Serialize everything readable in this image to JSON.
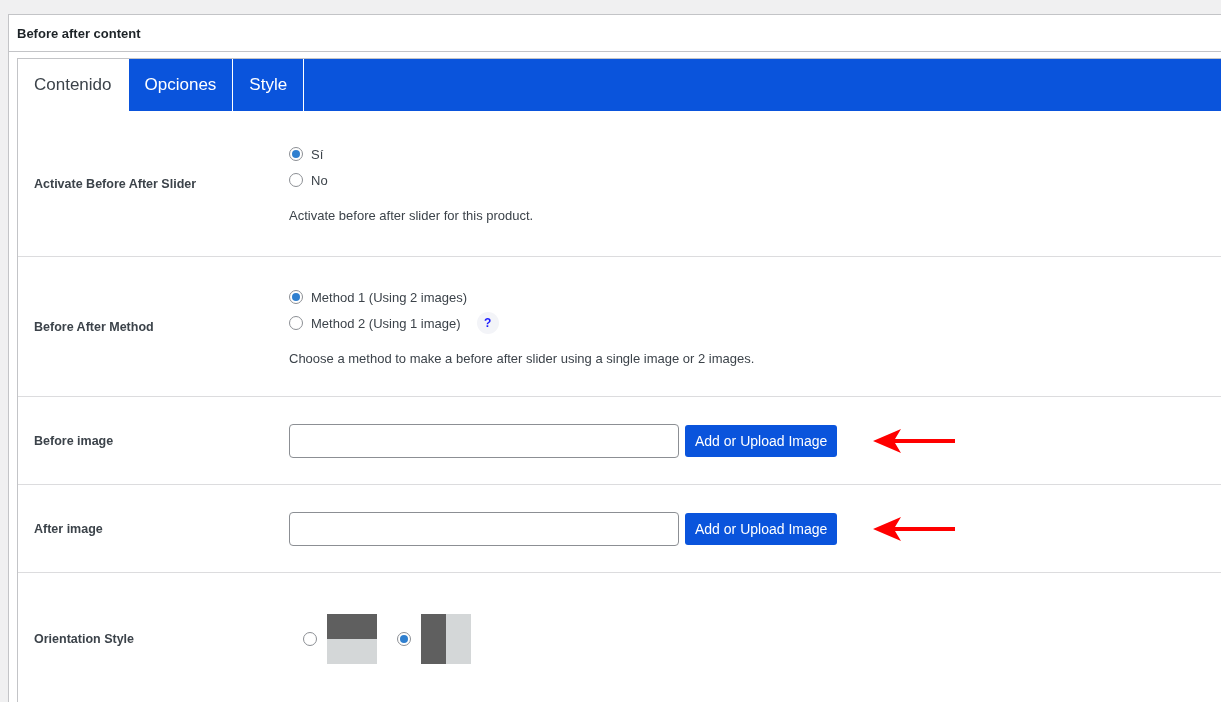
{
  "panel": {
    "title": "Before after content"
  },
  "tabs": [
    {
      "label": "Contenido",
      "selected": true
    },
    {
      "label": "Opciones",
      "selected": false
    },
    {
      "label": "Style",
      "selected": false
    }
  ],
  "rows": [
    {
      "kind": "radio",
      "label": "Activate Before After Slider",
      "options": [
        {
          "label": "Sí",
          "selected": true
        },
        {
          "label": "No",
          "selected": false
        }
      ],
      "description": "Activate before after slider for this product."
    },
    {
      "kind": "radio",
      "label": "Before After Method",
      "options": [
        {
          "label": "Method 1 (Using 2 images)",
          "selected": true
        },
        {
          "label": "Method 2 (Using 1 image)",
          "selected": false,
          "help_text": "?"
        }
      ],
      "description": "Choose a method to make a before after slider using a single image or 2 images."
    },
    {
      "kind": "image",
      "label": "Before image",
      "button": "Add or Upload Image",
      "annotated": true
    },
    {
      "kind": "image",
      "label": "After image",
      "button": "Add or Upload Image",
      "annotated": true
    },
    {
      "kind": "orientation",
      "label": "Orientation Style",
      "options": [
        {
          "kind": "horizontal",
          "selected": false
        },
        {
          "kind": "vertical",
          "selected": true
        }
      ]
    }
  ]
}
